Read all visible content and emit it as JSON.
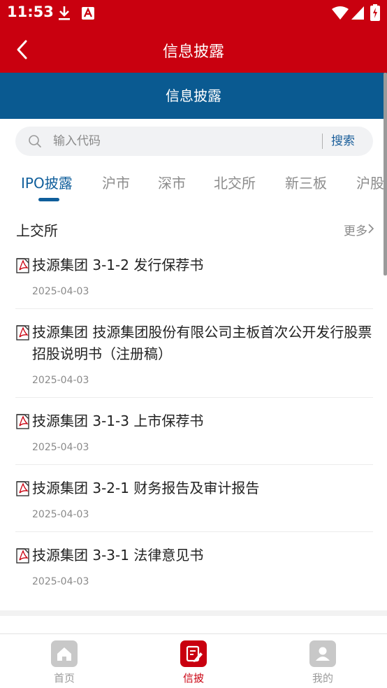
{
  "status_bar": {
    "time": "11:53"
  },
  "header": {
    "title": "信息披露"
  },
  "subheader": {
    "title": "信息披露"
  },
  "search": {
    "placeholder": "输入代码",
    "button_label": "搜索"
  },
  "tabs": [
    {
      "label": "IPO披露",
      "active": true
    },
    {
      "label": "沪市",
      "active": false
    },
    {
      "label": "深市",
      "active": false
    },
    {
      "label": "北交所",
      "active": false
    },
    {
      "label": "新三板",
      "active": false
    },
    {
      "label": "沪股",
      "active": false
    }
  ],
  "section": {
    "title": "上交所",
    "more_label": "更多"
  },
  "items": [
    {
      "title": "技源集团 3-1-2 发行保荐书",
      "date": "2025-04-03"
    },
    {
      "title": "技源集团 技源集团股份有限公司主板首次公开发行股票招股说明书（注册稿）",
      "date": "2025-04-03"
    },
    {
      "title": "技源集团 3-1-3 上市保荐书",
      "date": "2025-04-03"
    },
    {
      "title": "技源集团 3-2-1 财务报告及审计报告",
      "date": "2025-04-03"
    },
    {
      "title": "技源集团 3-3-1 法律意见书",
      "date": "2025-04-03"
    }
  ],
  "bottom_nav": [
    {
      "label": "首页",
      "icon": "home-icon",
      "active": false
    },
    {
      "label": "信披",
      "icon": "disclosure-icon",
      "active": true
    },
    {
      "label": "我的",
      "icon": "user-icon",
      "active": false
    }
  ],
  "colors": {
    "brand_red": "#c9000f",
    "header_blue": "#0a5a91",
    "accent_blue": "#0f5e9b"
  }
}
